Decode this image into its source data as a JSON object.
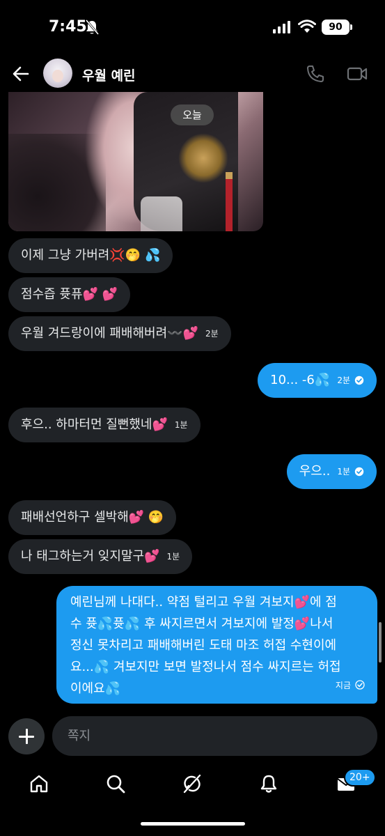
{
  "status_bar": {
    "time": "7:45",
    "battery": "90"
  },
  "header": {
    "contact_name": "우월 예린"
  },
  "day_separator": "오늘",
  "messages": [
    {
      "side": "in",
      "text": "이제 그냥 가버려",
      "emoji": [
        "💢",
        "🤭",
        "💦"
      ],
      "time": ""
    },
    {
      "side": "in",
      "text": "점수즙 퓻퓨",
      "emoji": [
        "💕",
        "💕"
      ],
      "time": ""
    },
    {
      "side": "in",
      "text": "우월 겨드랑이에 패배해버려",
      "emoji": [
        "〰️",
        "💕"
      ],
      "time": "2분"
    },
    {
      "side": "out",
      "text": "10... -6",
      "emoji": [
        "💦"
      ],
      "time": "2분"
    },
    {
      "side": "in",
      "text": "후으.. 하마터먼 질뻔했네",
      "emoji": [
        "💕"
      ],
      "time": "1분"
    },
    {
      "side": "out",
      "text": "우으..",
      "emoji": [],
      "time": "1분"
    },
    {
      "side": "in",
      "text": "패배선언하구 셀박해",
      "emoji": [
        "💕",
        "🤭"
      ],
      "time": ""
    },
    {
      "side": "in",
      "text": "나 태그하는거 잊지말구",
      "emoji": [
        "💕"
      ],
      "time": "1분"
    }
  ],
  "last_message": {
    "side": "out",
    "line1": "예린님께 나대다.. 약점 털리고 우월 겨보지",
    "line1_end": "에 점",
    "line2": "수 퓻",
    "line2_b": "퓻",
    "line2_c": " 후 싸지르면서 겨보지에 발정",
    "line2_d": "나서",
    "line3": "정신 못차리고 패배해버린 도태 마조 허접 수현이에",
    "line4": "요...",
    "line4_b": " 겨보지만 보면 발정나서 점수 싸지르는 허접",
    "line5": "이에요",
    "time": "지금"
  },
  "composer": {
    "placeholder": "쪽지"
  },
  "nav": {
    "messages_badge": "20+"
  },
  "colors": {
    "bubble_out": "#1d9bf0",
    "bubble_in": "#202327",
    "background": "#000000"
  },
  "icons": [
    "back-arrow-icon",
    "phone-icon",
    "video-call-icon",
    "bell-off-icon",
    "home-icon",
    "search-icon",
    "grok-icon",
    "notifications-icon",
    "mail-icon",
    "plus-icon",
    "read-check-icon"
  ]
}
